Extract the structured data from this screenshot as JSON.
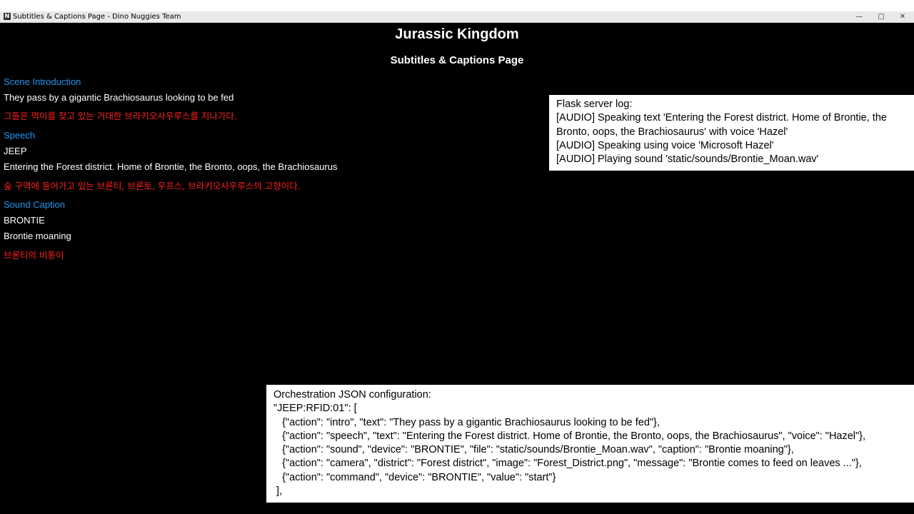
{
  "window": {
    "title": "Subtitles & Captions Page - Dino Nuggies Team",
    "controls": {
      "minimize": "—",
      "maximize": "▢",
      "close": "✕"
    },
    "app_icon": "N"
  },
  "page": {
    "title": "Jurassic Kingdom",
    "subtitle": "Subtitles & Captions Page",
    "sections": {
      "intro": {
        "heading": "Scene Introduction",
        "text_en": "They pass by a gigantic Brachiosaurus looking to be fed",
        "text_ko": "그들은 먹이를 찾고 있는 거대한 브라키오사우루스를 지나가다."
      },
      "speech": {
        "heading": "Speech",
        "speaker": "JEEP",
        "text_en": "Entering the Forest district. Home of Brontie, the Bronto, oops, the Brachiosaurus",
        "text_ko": "숲 구역에 들어가고 있는 브론티, 브론토, 우프스, 브라키오사우루스의 고향이다."
      },
      "sound": {
        "heading": "Sound Caption",
        "device": "BRONTIE",
        "text_en": "Brontie moaning",
        "text_ko": "브론티의 비통이"
      }
    }
  },
  "flask_log": {
    "title": "Flask server log:",
    "lines": [
      "[AUDIO] Speaking text 'Entering the Forest district. Home of Brontie, the",
      "Bronto, oops, the Brachiosaurus' with voice 'Hazel'",
      "[AUDIO] Speaking using voice 'Microsoft Hazel'",
      "[AUDIO] Playing sound 'static/sounds/Brontie_Moan.wav'"
    ]
  },
  "orchestration": {
    "title": "Orchestration JSON configuration:",
    "lines": [
      "\"JEEP:RFID:01\": [",
      "   {\"action\": \"intro\", \"text\": \"They pass by a gigantic Brachiosaurus looking to be fed\"},",
      "   {\"action\": \"speech\", \"text\": \"Entering the Forest district. Home of Brontie, the Bronto, oops, the Brachiosaurus\", \"voice\": \"Hazel\"},",
      "   {\"action\": \"sound\", \"device\": \"BRONTIE\", \"file\": \"static/sounds/Brontie_Moan.wav\", \"caption\": \"Brontie moaning\"},",
      "   {\"action\": \"camera\", \"district\": \"Forest district\", \"image\": \"Forest_District.png\", \"message\": \"Brontie comes to feed on leaves ...\"},",
      "   {\"action\": \"command\", \"device\": \"BRONTIE\", \"value\": \"start\"}",
      " ],"
    ]
  },
  "colors": {
    "background": "#000000",
    "heading": "#2196f3",
    "english_text": "#ffffff",
    "korean_text": "#ff1f1f"
  }
}
